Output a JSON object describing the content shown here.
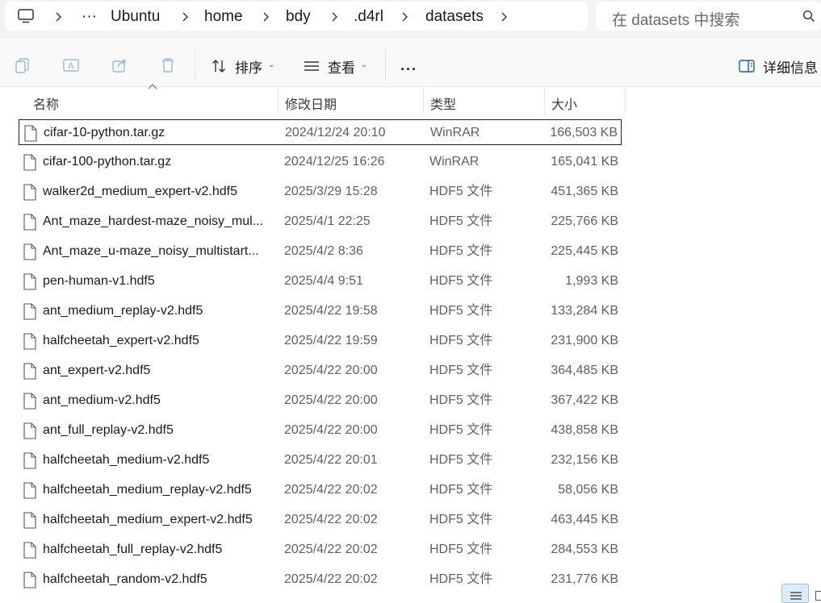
{
  "address_bar": {
    "crumbs": [
      "···",
      "Ubuntu",
      "home",
      "bdy",
      ".d4rl",
      "datasets"
    ]
  },
  "search": {
    "placeholder": "在 datasets 中搜索"
  },
  "toolbar": {
    "sort_label": "排序",
    "view_label": "查看",
    "more_label": "···",
    "details_label": "详细信息"
  },
  "columns": {
    "name": "名称",
    "modified": "修改日期",
    "type": "类型",
    "size": "大小"
  },
  "files": [
    {
      "name": "cifar-10-python.tar.gz",
      "modified": "2024/12/24 20:10",
      "type": "WinRAR",
      "size": "166,503 KB"
    },
    {
      "name": "cifar-100-python.tar.gz",
      "modified": "2024/12/25 16:26",
      "type": "WinRAR",
      "size": "165,041 KB"
    },
    {
      "name": "walker2d_medium_expert-v2.hdf5",
      "modified": "2025/3/29 15:28",
      "type": "HDF5 文件",
      "size": "451,365 KB"
    },
    {
      "name": "Ant_maze_hardest-maze_noisy_mul...",
      "modified": "2025/4/1 22:25",
      "type": "HDF5 文件",
      "size": "225,766 KB"
    },
    {
      "name": "Ant_maze_u-maze_noisy_multistart...",
      "modified": "2025/4/2 8:36",
      "type": "HDF5 文件",
      "size": "225,445 KB"
    },
    {
      "name": "pen-human-v1.hdf5",
      "modified": "2025/4/4 9:51",
      "type": "HDF5 文件",
      "size": "1,993 KB"
    },
    {
      "name": "ant_medium_replay-v2.hdf5",
      "modified": "2025/4/22 19:58",
      "type": "HDF5 文件",
      "size": "133,284 KB"
    },
    {
      "name": "halfcheetah_expert-v2.hdf5",
      "modified": "2025/4/22 19:59",
      "type": "HDF5 文件",
      "size": "231,900 KB"
    },
    {
      "name": "ant_expert-v2.hdf5",
      "modified": "2025/4/22 20:00",
      "type": "HDF5 文件",
      "size": "364,485 KB"
    },
    {
      "name": "ant_medium-v2.hdf5",
      "modified": "2025/4/22 20:00",
      "type": "HDF5 文件",
      "size": "367,422 KB"
    },
    {
      "name": "ant_full_replay-v2.hdf5",
      "modified": "2025/4/22 20:00",
      "type": "HDF5 文件",
      "size": "438,858 KB"
    },
    {
      "name": "halfcheetah_medium-v2.hdf5",
      "modified": "2025/4/22 20:01",
      "type": "HDF5 文件",
      "size": "232,156 KB"
    },
    {
      "name": "halfcheetah_medium_replay-v2.hdf5",
      "modified": "2025/4/22 20:02",
      "type": "HDF5 文件",
      "size": "58,056 KB"
    },
    {
      "name": "halfcheetah_medium_expert-v2.hdf5",
      "modified": "2025/4/22 20:02",
      "type": "HDF5 文件",
      "size": "463,445 KB"
    },
    {
      "name": "halfcheetah_full_replay-v2.hdf5",
      "modified": "2025/4/22 20:02",
      "type": "HDF5 文件",
      "size": "284,553 KB"
    },
    {
      "name": "halfcheetah_random-v2.hdf5",
      "modified": "2025/4/22 20:02",
      "type": "HDF5 文件",
      "size": "231,776 KB"
    }
  ],
  "selected_file": "cifar-10-python.tar.gz"
}
